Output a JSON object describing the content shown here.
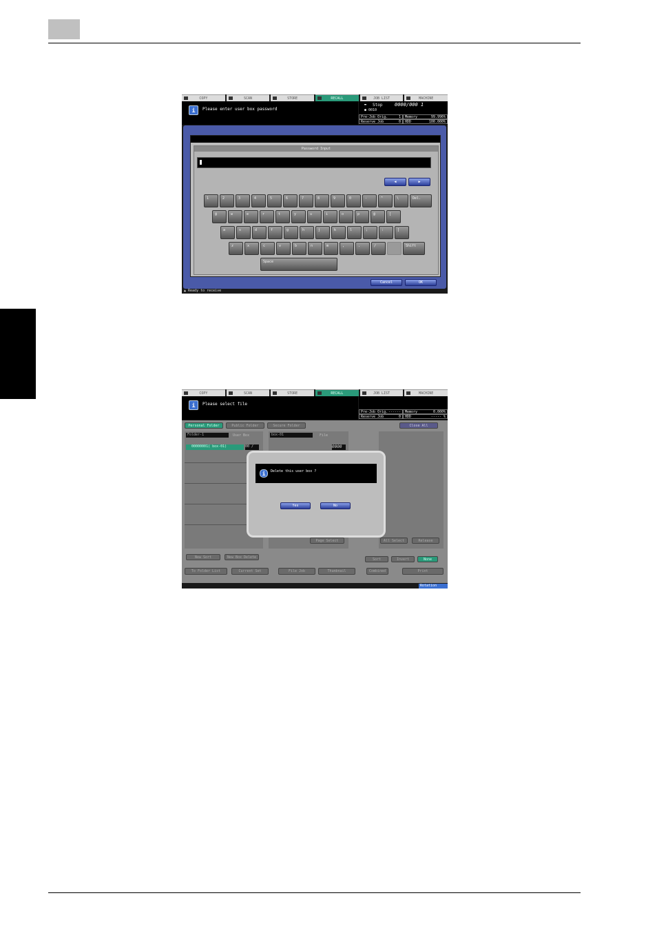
{
  "screen1": {
    "tabs": [
      {
        "label": "COPY"
      },
      {
        "label": "SCAN"
      },
      {
        "label": "STORE"
      },
      {
        "label": "RECALL",
        "active": true
      },
      {
        "label": "JOB LIST"
      },
      {
        "label": "MACHINE"
      }
    ],
    "message": "Please enter user box password",
    "status": {
      "state": "Stop",
      "counter": "0000/000 1",
      "user": "0010",
      "prejob_label": "Pre-Job Orig.",
      "prejob_value": "1",
      "memory_label": "Memory",
      "memory_value": "99.996%",
      "reserve_label": "Reserve Job",
      "reserve_value": "0",
      "hdd_label": "HDD",
      "hdd_value": "100.000%"
    },
    "dialog_title": "Password Input",
    "row1": [
      "1",
      "2",
      "3",
      "4",
      "5",
      "6",
      "7",
      "8",
      "9",
      "0",
      "-",
      "^",
      "\\",
      "Del."
    ],
    "row2": [
      "@",
      "w",
      "e",
      "r",
      "t",
      "y",
      "u",
      "i",
      "o",
      "p",
      "@",
      "["
    ],
    "row3": [
      "a",
      "s",
      "d",
      "f",
      "g",
      "h",
      "j",
      "k",
      "l",
      ";",
      ":",
      "]"
    ],
    "row4": [
      "z",
      "x",
      "c",
      "v",
      "b",
      "n",
      "m",
      ",",
      ".",
      "/",
      "",
      "Shift"
    ],
    "space_label": "Space",
    "cancel_label": "Cancel",
    "ok_label": "OK",
    "footer": "Ready to receive"
  },
  "screen2": {
    "tabs": [
      {
        "label": "COPY"
      },
      {
        "label": "SCAN"
      },
      {
        "label": "STORE"
      },
      {
        "label": "RECALL",
        "active": true
      },
      {
        "label": "JOB LIST"
      },
      {
        "label": "MACHINE"
      }
    ],
    "message": "Please select file",
    "status": {
      "prejob_label": "Pre-Job Orig.",
      "prejob_value": "------",
      "memory_label": "Memory",
      "memory_value": "0.000%",
      "reserve_label": "Reserve Job",
      "reserve_value": "0",
      "hdd_label": "HDD",
      "hdd_value": "----- %"
    },
    "top_tabs": [
      "Personal Folder",
      "Public Folder",
      "Secure Folder"
    ],
    "close_all": "Close All",
    "folder_field": "Folder-1",
    "userbox_label": "User Box",
    "box_field": "box-01",
    "file_label": "File",
    "selected_item": "00000001( box-01)",
    "selected_count": "00 /",
    "file_count": "0000",
    "dialog_message": "Delete this user box ?",
    "yes_label": "Yes",
    "no_label": "No",
    "btn_new": "New Sort",
    "btn_new_box": "New Box Delete",
    "btn_page": "Page Select",
    "btn_all": "All Select",
    "btn_release": "Release",
    "btn_sort": "Sort",
    "btn_invert": "Invert",
    "btn_none": "None",
    "btn_folder_list": "To Folder List",
    "btn_current": "Current Set",
    "btn_file_job": "File Job",
    "btn_thumbnail": "Thumbnail",
    "btn_combined": "Combined",
    "btn_print": "Print",
    "footer_right": "Rotation"
  }
}
